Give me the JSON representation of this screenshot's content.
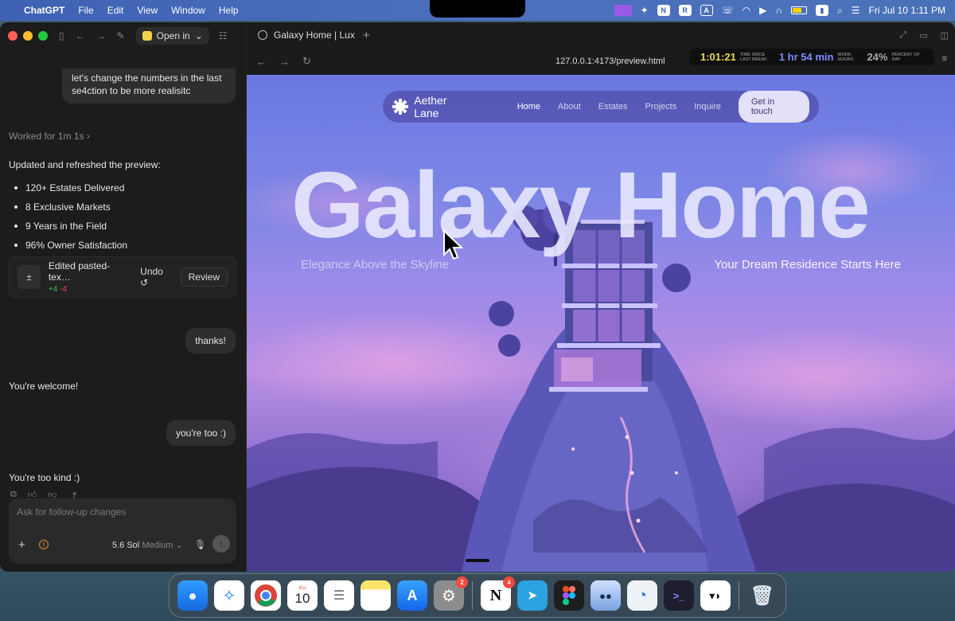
{
  "menubar": {
    "app_name": "ChatGPT",
    "menus": [
      "File",
      "Edit",
      "View",
      "Window",
      "Help"
    ],
    "status_letters": [
      "N",
      "R",
      "A"
    ],
    "datetime": "Fri Jul 10  1:11 PM"
  },
  "chat": {
    "toolbar": {
      "open_in_label": "Open in"
    },
    "user_message_1": "let's change the numbers in the last se4ction to be more realisitc",
    "worked_for": "Worked for 1m 1s",
    "updated_text": "Updated and refreshed the preview:",
    "bullets": [
      "120+ Estates Delivered",
      "8 Exclusive Markets",
      "9 Years in the Field",
      "96% Owner Satisfaction"
    ],
    "edit_card": {
      "title": "Edited pasted-tex…",
      "added": "+4",
      "removed": "-4",
      "undo_label": "Undo",
      "review_label": "Review"
    },
    "user_message_2": "thanks!",
    "assistant_1": "You're welcome!",
    "user_message_3": "you're too :)",
    "assistant_2": "You're too kind :)",
    "composer": {
      "placeholder": "Ask for follow-up changes",
      "model": "5.6 Sol",
      "effort": "Medium"
    }
  },
  "browser": {
    "tab_title": "Galaxy Home | Lux",
    "url": "127.0.0.1:4173/preview.html",
    "timer": {
      "time_since_break": "1:01:21",
      "time_since_break_label": "TIME SINCE LAST BREAK",
      "work_hours": "1 hr 54 min",
      "work_hours_label": "WORK HOURS",
      "percent_of_day": "24%",
      "percent_of_day_label": "PERCENT OF DAY"
    }
  },
  "site": {
    "brand": "Aether Lane",
    "nav": [
      "Home",
      "About",
      "Estates",
      "Projects",
      "Inquire"
    ],
    "cta": "Get in touch",
    "hero_title": "Galaxy  Home",
    "subtitle_left": "Elegance Above the Skyline",
    "subtitle_right": "Your Dream Residence Starts Here"
  },
  "dock": {
    "calendar": {
      "month": "Fri",
      "day": "10"
    },
    "badges": {
      "settings": "2",
      "notion": "4"
    }
  },
  "colors": {
    "menubar": "#4a6eb8",
    "accent_timer_yellow": "#e8d85a",
    "accent_timer_blue": "#7d8cff",
    "diff_add": "#3fb950",
    "diff_remove": "#e5534b"
  }
}
